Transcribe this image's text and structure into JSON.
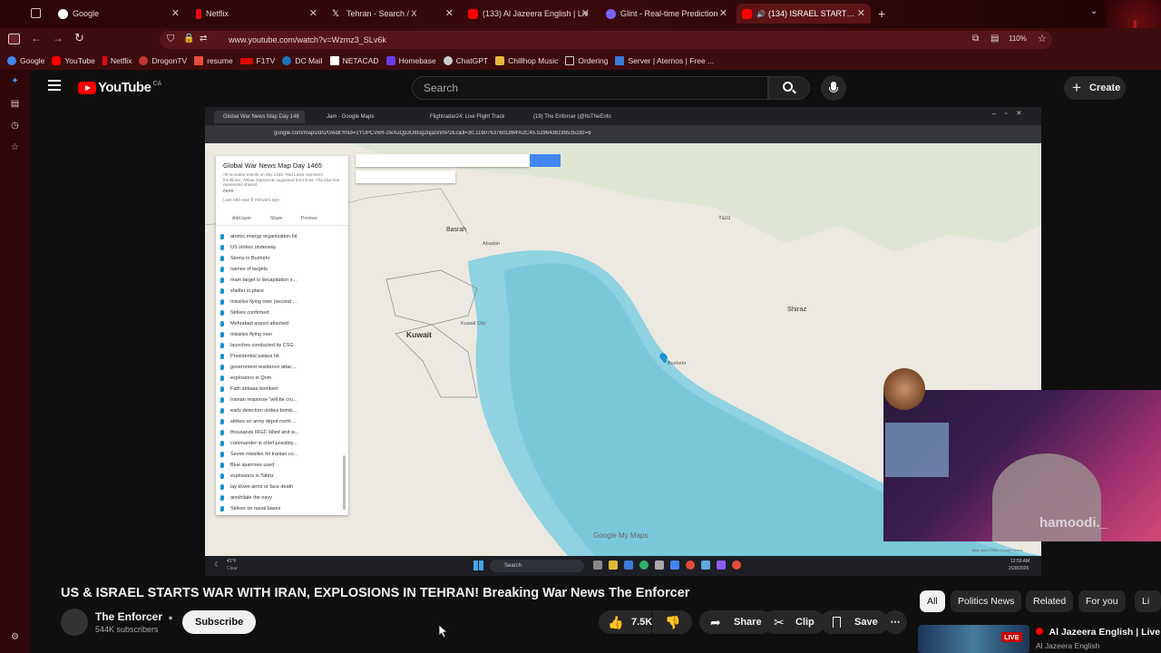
{
  "browser": {
    "tabs": [
      {
        "label": "Google",
        "favicon_color": "#4285f4"
      },
      {
        "label": "Netflix",
        "favicon_color": "#e50914"
      },
      {
        "label": "Tehran - Search / X",
        "favicon_color": "#ffffff"
      },
      {
        "label": "(133) Al Jazeera English | Liv",
        "favicon_color": "#ff0000"
      },
      {
        "label": "Glint - Real-time Prediction",
        "favicon_color": "#7b61ff"
      },
      {
        "label": "(134) ISRAEL STARTS WAR W",
        "favicon_color": "#ff0000"
      }
    ],
    "url": "www.youtube.com/watch?v=Wzmz3_SLv6k",
    "zoom": "110%",
    "bookmarks": [
      {
        "label": "Google",
        "color": "#4285f4"
      },
      {
        "label": "YouTube",
        "color": "#ff0000"
      },
      {
        "label": "Netflix",
        "color": "#e50914"
      },
      {
        "label": "DrogonTV",
        "color": "#c0392b"
      },
      {
        "label": "resume",
        "color": "#e74c3c"
      },
      {
        "label": "F1TV",
        "color": "#e10600"
      },
      {
        "label": "DC Mail",
        "color": "#1e73be"
      },
      {
        "label": "NETACAD",
        "color": "#ffffff"
      },
      {
        "label": "Homebase",
        "color": "#6a3de8"
      },
      {
        "label": "ChatGPT",
        "color": "#cccccc"
      },
      {
        "label": "Chillhop Music",
        "color": "#e2b93b"
      },
      {
        "label": "Ordering",
        "color": "#cccccc"
      },
      {
        "label": "Server | Aternos | Free ...",
        "color": "#3d7bd9"
      }
    ]
  },
  "youtube": {
    "logo_text": "YouTube",
    "logo_region": "CA",
    "search_placeholder": "Search",
    "create_label": "Create",
    "video": {
      "inner_tabs": [
        "Global War News Map Day 146",
        "Jam - Google Maps",
        "Flightradar24: Live Flight Track",
        "(19) The Enforcer (@ItsTheEnfo"
      ],
      "inner_url": "google.com/maps/d/u/0/edit?mid=1YUPCVkR-2wXuQp3U8Gg2ujaSnmP2Ec&ll=30.11907637601884%2C45.529643619953528z=6",
      "panel_title": "Global War News Map Day 1465",
      "panel_desc": "All recorded events on day 1465. Red Lines represent frontlines, Yellow represents supposed front lines. The blue line represents shared",
      "panel_more": "more",
      "panel_last_edit": "Last edit was 8 minutes ago",
      "panel_actions": [
        "Add layer",
        "Share",
        "Preview"
      ],
      "panel_items": [
        "atomic energy organization hit",
        "US strikes underway",
        "Sirens in Bushehr",
        "names of targets",
        "main target is decapitation s...",
        "shelter in place",
        "missiles flying over (second ...",
        "Strikes confirmed",
        "Mehrabad airport attacked",
        "missiles flying over",
        "launches conducted by CSG",
        "Presidential palace hit",
        "government residence attac...",
        "explosions in Qom",
        "Fath airbase bombed",
        "Iranian response \"will be cru...",
        "early detection strikes bomb...",
        "strikes on army depot north ...",
        "thousands IRGC killed and w...",
        "commander in chief possibly...",
        "Seven missiles hit Iranian co...",
        "Blue sparrows used",
        "explosions in Tabriz",
        "lay down arms or face death",
        "annihilate the navy",
        "Strikes on naval bases"
      ],
      "map_labels": {
        "kuwait": "Kuwait",
        "basrah": "Basrah",
        "shiraz": "Shiraz",
        "yazd": "Yazd",
        "abadan": "Abadan",
        "kuwait_city": "Kuwait City",
        "bushehr": "Bushehr",
        "watermark": "Google My Maps",
        "map_data": "Map data ©2026 Google  Terms"
      },
      "taskbar": {
        "weather_temp": "41°F",
        "weather_desc": "Clear",
        "search": "Search",
        "time": "12:59 AM",
        "date": "2/28/2026"
      },
      "webcam_tag": "hamoodi._"
    },
    "title": "US & ISRAEL STARTS WAR WITH IRAN, EXPLOSIONS IN TEHRAN! Breaking War News The Enforcer",
    "channel_name": "The Enforcer",
    "subscribers": "544K subscribers",
    "subscribe_label": "Subscribe",
    "likes": "7.5K",
    "share_label": "Share",
    "clip_label": "Clip",
    "save_label": "Save",
    "chips": [
      "All",
      "Politics News",
      "Related",
      "For you",
      "Li"
    ],
    "rec": {
      "channel_title": "Al Jazeera English | Live",
      "channel_sub": "Al Jazeera English",
      "live_badge": "LIVE"
    }
  }
}
